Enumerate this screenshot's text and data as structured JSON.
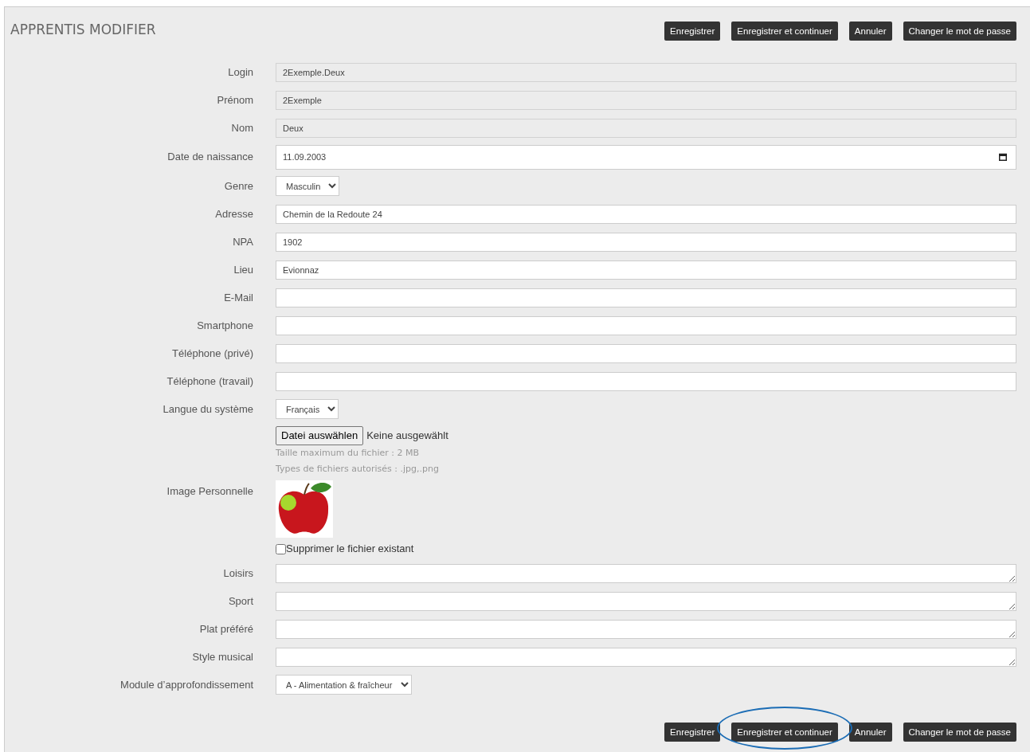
{
  "title": "APPRENTIS MODIFIER",
  "top_buttons": [
    {
      "label": "Enregistrer"
    },
    {
      "label": "Enregistrer et continuer"
    },
    {
      "label": "Annuler"
    },
    {
      "label": "Changer le mot de passe"
    }
  ],
  "fields": [
    {
      "kind": "readonly",
      "label": "Login",
      "value": "2Exemple.Deux"
    },
    {
      "kind": "readonly",
      "label": "Prénom",
      "value": "2Exemple"
    },
    {
      "kind": "readonly",
      "label": "Nom",
      "value": "Deux"
    },
    {
      "kind": "date",
      "label": "Date de naissance",
      "value": "11.09.2003"
    },
    {
      "kind": "select",
      "label": "Genre",
      "value": "Masculin"
    },
    {
      "kind": "text",
      "label": "Adresse",
      "value": "Chemin de la Redoute 24"
    },
    {
      "kind": "text",
      "label": "NPA",
      "value": "1902"
    },
    {
      "kind": "text",
      "label": "Lieu",
      "value": "Evionnaz"
    },
    {
      "kind": "text",
      "label": "E-Mail"
    },
    {
      "kind": "text",
      "label": "Smartphone"
    },
    {
      "kind": "text",
      "label": "Téléphone (privé)"
    },
    {
      "kind": "text",
      "label": "Téléphone (travail)"
    },
    {
      "kind": "select",
      "label": "Langue du système",
      "value": "Français"
    },
    {
      "kind": "image",
      "label": "Image Personnelle",
      "file_button": "Datei auswählen",
      "file_status": "Keine ausgewählt",
      "hints": [
        "Taille maximum du fichier : 2 MB",
        "Types de fichiers autorisés : .jpg,.png"
      ],
      "delete_label": "Supprimer le fichier existant",
      "delete_checked": false
    },
    {
      "kind": "textarea",
      "label": "Loisirs"
    },
    {
      "kind": "textarea",
      "label": "Sport"
    },
    {
      "kind": "textarea",
      "label": "Plat préféré"
    },
    {
      "kind": "textarea",
      "label": "Style musical"
    },
    {
      "kind": "select",
      "label": "Module d’approfondissement",
      "value": "A - Alimentation & fraîcheur"
    }
  ],
  "bottom_buttons": [
    {
      "label": "Enregistrer",
      "highlighted": false
    },
    {
      "label": "Enregistrer et continuer",
      "highlighted": true
    },
    {
      "label": "Annuler",
      "highlighted": false
    },
    {
      "label": "Changer le mot de passe",
      "highlighted": false
    }
  ]
}
